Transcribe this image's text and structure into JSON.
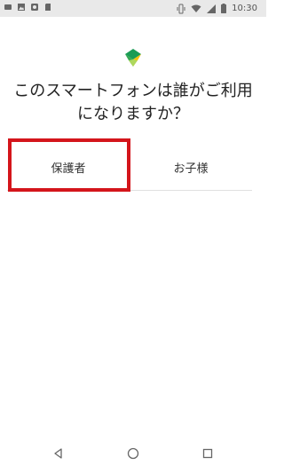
{
  "status_bar": {
    "time": "10:30",
    "left_icons": [
      "app-icon",
      "image-icon",
      "app-icon-2",
      "sd-card-icon"
    ],
    "right_icons": [
      "vibrate-icon",
      "wifi-icon",
      "signal-icon",
      "battery-icon"
    ]
  },
  "app": {
    "logo": "google-family-link-logo"
  },
  "question": {
    "line1": "このスマートフォンは誰がご利用",
    "line2": "になりますか？"
  },
  "choices": {
    "parent_label": "保護者",
    "child_label": "お子様",
    "highlight_color": "#d4151b"
  },
  "nav": {
    "back": "back-icon",
    "home": "home-icon",
    "recents": "recents-icon"
  }
}
